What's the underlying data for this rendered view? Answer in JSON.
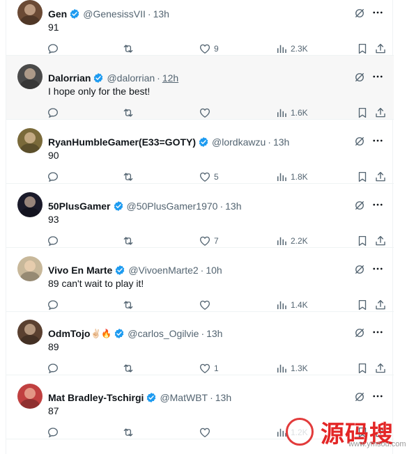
{
  "tweets": [
    {
      "name": "Gen",
      "handle": "@GenesissVII",
      "time": "13h",
      "text": "91",
      "likes": "9",
      "views": "2.3K",
      "avatar_color": "#6b4a35"
    },
    {
      "name": "Dalorrian",
      "handle": "@dalorrian",
      "time": "12h",
      "text": "I hope only for the best!",
      "likes": "",
      "views": "1.6K",
      "avatar_color": "#4a4a4a"
    },
    {
      "name": "RyanHumbleGamer(E33=GOTY)",
      "handle": "@lordkawzu",
      "time": "13h",
      "text": "90",
      "likes": "5",
      "views": "1.8K",
      "avatar_color": "#7a6a3a"
    },
    {
      "name": "50PlusGamer",
      "handle": "@50PlusGamer1970",
      "time": "13h",
      "text": "93",
      "likes": "7",
      "views": "2.2K",
      "avatar_color": "#1a1a2a"
    },
    {
      "name": "Vivo En Marte",
      "handle": "@VivoenMarte2",
      "time": "10h",
      "text": "89 can't wait to play it!",
      "likes": "",
      "views": "1.4K",
      "avatar_color": "#c8b89a"
    },
    {
      "name": "OdmTojo",
      "handle": "@carlos_Ogilvie",
      "time": "13h",
      "text": "89",
      "likes": "1",
      "views": "1.3K",
      "avatar_color": "#5a4030"
    },
    {
      "name": "Mat Bradley-Tschirgi",
      "handle": "@MatWBT",
      "time": "13h",
      "text": "87",
      "likes": "",
      "views": "1.2K",
      "avatar_color": "#c04040"
    }
  ],
  "odm_emoji": "✌🏻🔥",
  "separator": "·",
  "verified_color": "#1d9bf0",
  "watermark": {
    "text": "源码搜",
    "url": "www.ymsou.com"
  }
}
